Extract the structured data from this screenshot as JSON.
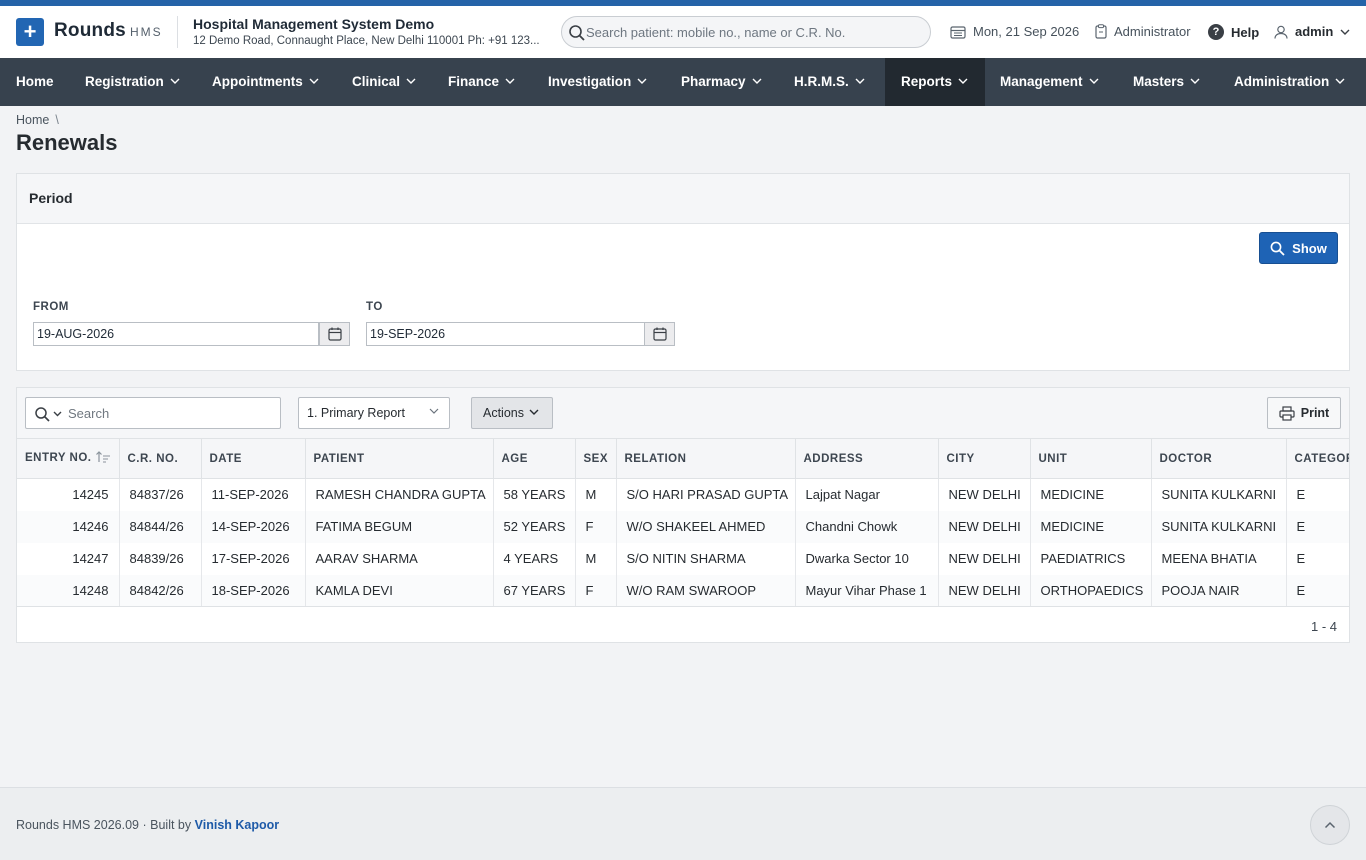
{
  "app": {
    "brand_name": "Rounds",
    "brand_sub": "HMS",
    "org_name": "Hospital Management System Demo",
    "org_address": "12 Demo Road, Connaught Place, New Delhi 110001 Ph: +91 123...",
    "search_placeholder": "Search patient: mobile no., name or C.R. No.",
    "date": "Mon, 21 Sep 2026",
    "role": "Administrator",
    "help_label": "Help",
    "user": "admin"
  },
  "nav": {
    "items": [
      {
        "label": "Home"
      },
      {
        "label": "Registration"
      },
      {
        "label": "Appointments"
      },
      {
        "label": "Clinical"
      },
      {
        "label": "Finance"
      },
      {
        "label": "Investigation"
      },
      {
        "label": "Pharmacy"
      },
      {
        "label": "H.R.M.S."
      },
      {
        "label": "Reports",
        "active": true
      },
      {
        "label": "Management"
      },
      {
        "label": "Masters"
      },
      {
        "label": "Administration"
      }
    ]
  },
  "breadcrumb": {
    "home": "Home",
    "sep": "\\"
  },
  "page": {
    "title": "Renewals"
  },
  "period": {
    "title": "Period",
    "show_label": "Show",
    "from_label": "FROM",
    "from_value": "19-AUG-2026",
    "to_label": "TO",
    "to_value": "19-SEP-2026"
  },
  "report": {
    "search_placeholder": "Search",
    "report_select": "1. Primary Report",
    "actions_label": "Actions",
    "print_label": "Print",
    "columns": [
      "ENTRY NO.",
      "C.R. NO.",
      "DATE",
      "PATIENT",
      "AGE",
      "SEX",
      "RELATION",
      "ADDRESS",
      "CITY",
      "UNIT",
      "DOCTOR",
      "CATEGORY"
    ],
    "rows": [
      {
        "entry_no": "14245",
        "cr_no": "84837/26",
        "date": "11-SEP-2026",
        "patient": "RAMESH CHANDRA GUPTA",
        "age": "58 YEARS",
        "sex": "M",
        "relation": "S/O HARI PRASAD GUPTA",
        "address": "Lajpat Nagar",
        "city": "NEW DELHI",
        "unit": "MEDICINE",
        "doctor": "SUNITA KULKARNI",
        "category": "E"
      },
      {
        "entry_no": "14246",
        "cr_no": "84844/26",
        "date": "14-SEP-2026",
        "patient": "FATIMA BEGUM",
        "age": "52 YEARS",
        "sex": "F",
        "relation": "W/O SHAKEEL AHMED",
        "address": "Chandni Chowk",
        "city": "NEW DELHI",
        "unit": "MEDICINE",
        "doctor": "SUNITA KULKARNI",
        "category": "E"
      },
      {
        "entry_no": "14247",
        "cr_no": "84839/26",
        "date": "17-SEP-2026",
        "patient": "AARAV SHARMA",
        "age": "4 YEARS",
        "sex": "M",
        "relation": "S/O NITIN SHARMA",
        "address": "Dwarka Sector 10",
        "city": "NEW DELHI",
        "unit": "PAEDIATRICS",
        "doctor": "MEENA BHATIA",
        "category": "E"
      },
      {
        "entry_no": "14248",
        "cr_no": "84842/26",
        "date": "18-SEP-2026",
        "patient": "KAMLA DEVI",
        "age": "67 YEARS",
        "sex": "F",
        "relation": "W/O RAM SWAROOP",
        "address": "Mayur Vihar Phase 1",
        "city": "NEW DELHI",
        "unit": "ORTHOPAEDICS",
        "doctor": "POOJA NAIR",
        "category": "E"
      }
    ],
    "pagination": "1 - 4"
  },
  "footer": {
    "version": "Rounds HMS 2026.09",
    "sep": "·",
    "built_by_label": "Built by",
    "author": "Vinish Kapoor"
  },
  "icons": {
    "brand": "plus-icon",
    "search": "search-icon",
    "calendar": "calendar-icon",
    "role": "clipboard-icon",
    "help": "question-icon",
    "user": "user-icon",
    "print": "printer-icon",
    "to_top": "chevron-up-icon"
  },
  "colors": {
    "topbar_accent": "#2563a8",
    "navbar": "#37424e",
    "nav_active": "#222930",
    "primary_button": "#1e63b5",
    "link": "#1e5aa8"
  }
}
